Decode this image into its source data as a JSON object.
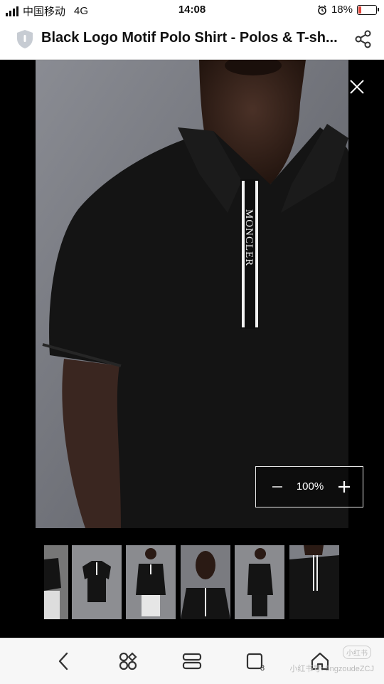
{
  "status_bar": {
    "carrier": "中国移动",
    "network": "4G",
    "time": "14:08",
    "battery": "18%",
    "battery_level": 0.18,
    "battery_color": "#e2463b"
  },
  "header": {
    "title": "Black Logo Motif Polo Shirt - Polos & T-sh...",
    "shield_icon": "shield-icon",
    "share_icon": "share-icon"
  },
  "viewer": {
    "placket_brand": "MONCLER",
    "close_icon": "close-icon",
    "zoom": {
      "level": "100%",
      "minus_icon": "minus-icon",
      "plus_icon": "plus-icon"
    },
    "thumbnails": [
      {
        "label": "thumbnail 1"
      },
      {
        "label": "thumbnail 2"
      },
      {
        "label": "thumbnail 3"
      },
      {
        "label": "thumbnail 4"
      },
      {
        "label": "thumbnail 5"
      },
      {
        "label": "thumbnail 6"
      }
    ]
  },
  "toolbar": {
    "items": [
      {
        "icon": "back-icon"
      },
      {
        "icon": "apps-icon"
      },
      {
        "icon": "menu-icon"
      },
      {
        "icon": "tabs-icon",
        "count": "3"
      },
      {
        "icon": "home-icon"
      }
    ]
  },
  "watermark": {
    "badge": "小红书",
    "text": "小红书号: 5ngzoudeZCJ"
  }
}
